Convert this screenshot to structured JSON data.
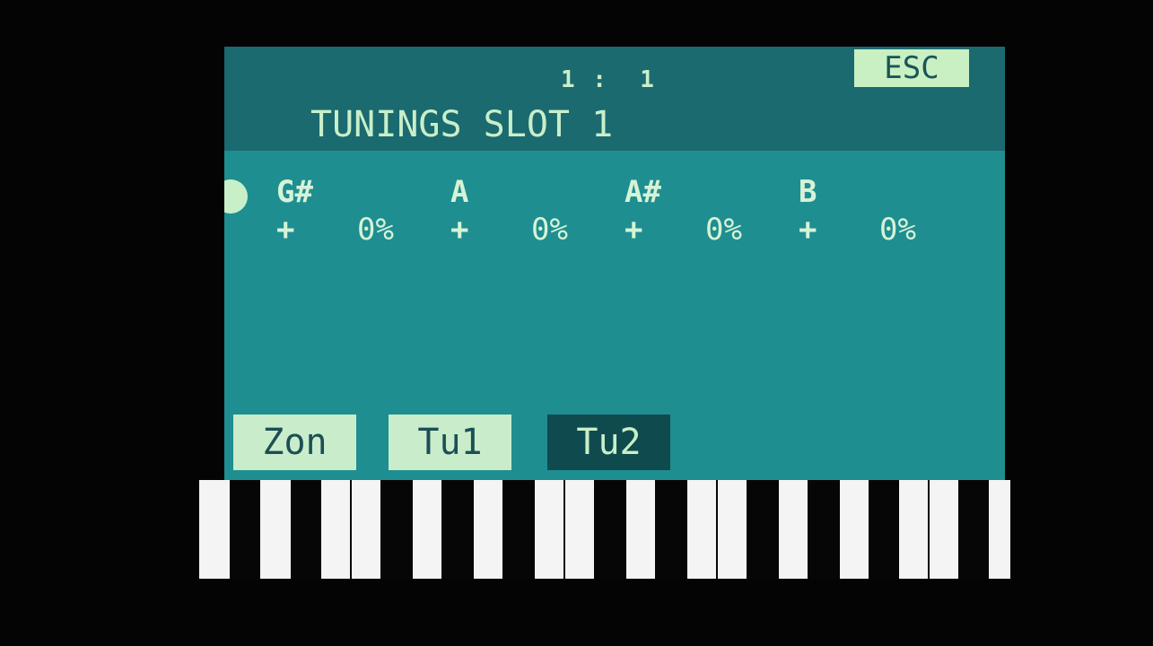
{
  "header": {
    "position_readout": "1 :  1",
    "title": "TUNINGS SLOT 1",
    "esc_label": "ESC"
  },
  "notes": [
    {
      "name": "G#",
      "sign": "+",
      "value": "0%"
    },
    {
      "name": "A",
      "sign": "+",
      "value": "0%"
    },
    {
      "name": "A#",
      "sign": "+",
      "value": "0%"
    },
    {
      "name": "B",
      "sign": "+",
      "value": "0%"
    }
  ],
  "tabs": [
    {
      "label": "Zon",
      "selected": false
    },
    {
      "label": "Tu1",
      "selected": false
    },
    {
      "label": "Tu2",
      "selected": true
    }
  ],
  "colors": {
    "screen_bg": "#1f8e91",
    "header_bg": "#1a6a70",
    "text": "#c9efc9",
    "highlight": "#c9f0c2"
  }
}
